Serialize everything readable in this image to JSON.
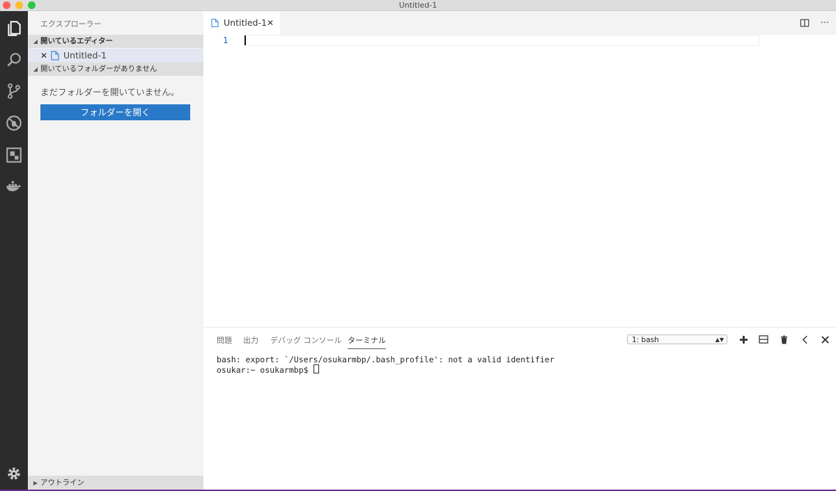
{
  "window": {
    "title": "Untitled-1"
  },
  "activity_bar": {
    "items": [
      {
        "icon": "files-icon"
      },
      {
        "icon": "search-icon"
      },
      {
        "icon": "source-control-icon"
      },
      {
        "icon": "debug-icon"
      },
      {
        "icon": "extensions-icon"
      },
      {
        "icon": "docker-icon"
      }
    ],
    "settings_icon": "gear-icon"
  },
  "sidebar": {
    "title": "エクスプローラー",
    "open_editors_label": "開いているエディター",
    "open_files": [
      {
        "name": "Untitled-1"
      }
    ],
    "no_folder_label": "開いているフォルダーがありません",
    "message": "まだフォルダーを開いていません。",
    "open_folder_button": "フォルダーを開く",
    "outline_label": "アウトライン"
  },
  "editor": {
    "tab_label": "Untitled-1",
    "line_numbers": [
      "1"
    ]
  },
  "panel": {
    "tabs": [
      "問題",
      "出力",
      "デバッグ コンソール",
      "ターミナル"
    ],
    "active_tab": "ターミナル",
    "terminal_select_value": "1: bash",
    "terminal_lines": [
      "bash: export: `/Users/osukarmbp/.bash_profile': not a valid identifier",
      "osukar:~ osukarmbp$ "
    ]
  },
  "colors": {
    "activity_bg": "#2c2c2c",
    "sidebar_bg": "#f3f3f3",
    "button_blue": "#2979c8",
    "line_number": "#2060b0"
  }
}
